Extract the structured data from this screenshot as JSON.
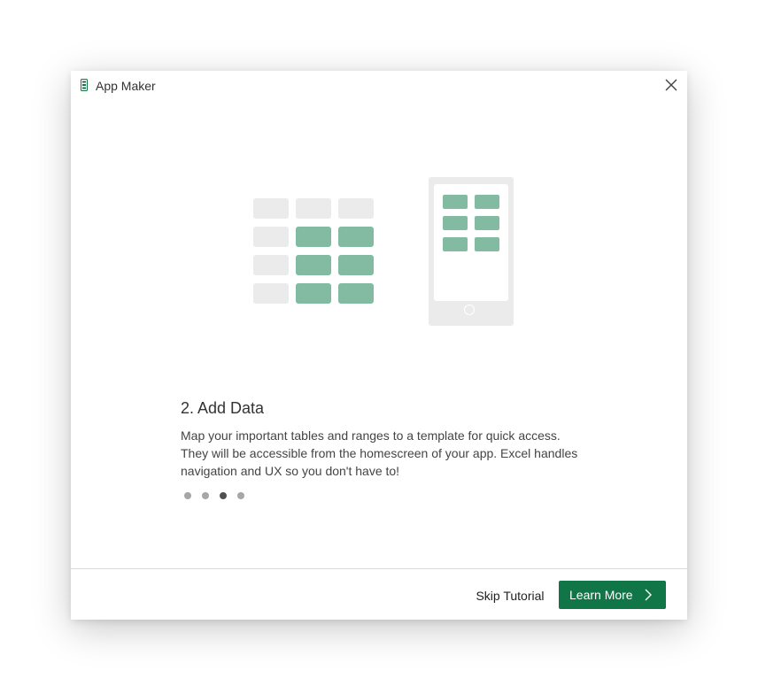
{
  "window": {
    "title": "App Maker",
    "icon": "phone-app-icon",
    "close_icon": "close-icon"
  },
  "illustration": {
    "description_icons": [
      "table-grid-icon",
      "phone-icon"
    ],
    "colors": {
      "gray": "#ebebeb",
      "green": "#82bba1"
    }
  },
  "step": {
    "title": "2. Add Data",
    "description": "Map your important tables and ranges to a template for quick access. They will be accessible from the homescreen of your app. Excel handles navigation and UX so you don't have to!"
  },
  "pagination": {
    "total": 4,
    "active_index": 2
  },
  "footer": {
    "skip_label": "Skip Tutorial",
    "learn_label": "Learn More",
    "learn_icon": "chevron-right-icon",
    "accent": "#107547"
  }
}
